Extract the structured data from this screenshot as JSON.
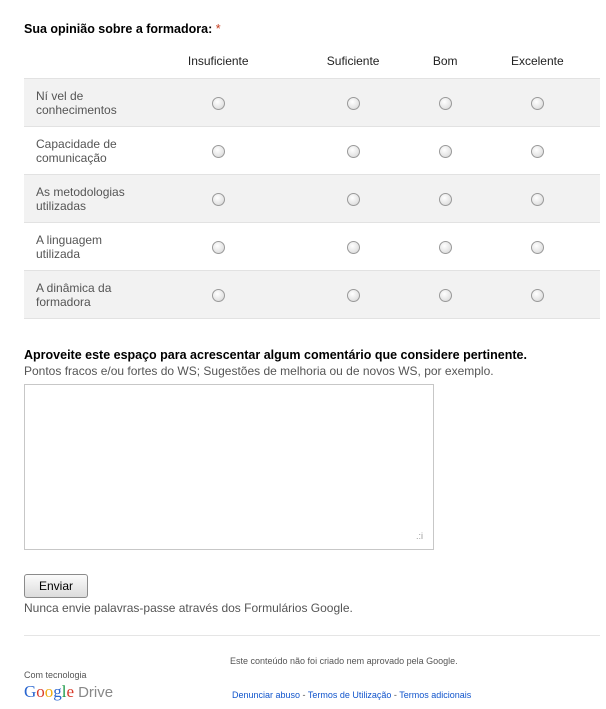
{
  "question": {
    "title": "Sua opinião sobre a formadora:",
    "required_mark": "*"
  },
  "grid": {
    "columns": [
      "Insuficiente",
      "Suficiente",
      "Bom",
      "Excelente"
    ],
    "rows": [
      {
        "line1": "Ní vel de",
        "line2": "conhecimentos"
      },
      {
        "line1": "Capacidade de",
        "line2": "comunicação"
      },
      {
        "line1": "As metodologias",
        "line2": "utilizadas"
      },
      {
        "line1": "A linguagem",
        "line2": "utilizada"
      },
      {
        "line1": "A dinâmica da",
        "line2": "formadora"
      }
    ]
  },
  "comment": {
    "title": "Aproveite este espaço para acrescentar algum comentário que considere pertinente.",
    "help": "Pontos fracos e/ou fortes do WS; Sugestões de melhoria ou de novos WS, por exemplo.",
    "value": ""
  },
  "submit": {
    "label": "Enviar"
  },
  "password_warning": "Nunca envie palavras-passe através dos Formulários Google.",
  "footer": {
    "disclaimer": "Este conteúdo não foi criado nem aprovado pela Google.",
    "powered_by": "Com tecnologia",
    "logo_google": "Google",
    "logo_drive": "Drive",
    "links": {
      "abuse": "Denunciar abuso",
      "terms": "Termos de Utilização",
      "additional": "Termos adicionais",
      "separator": " - "
    }
  },
  "icons": {
    "radio": "radio-button-unchecked-icon",
    "resize": "resize-grip-icon"
  }
}
